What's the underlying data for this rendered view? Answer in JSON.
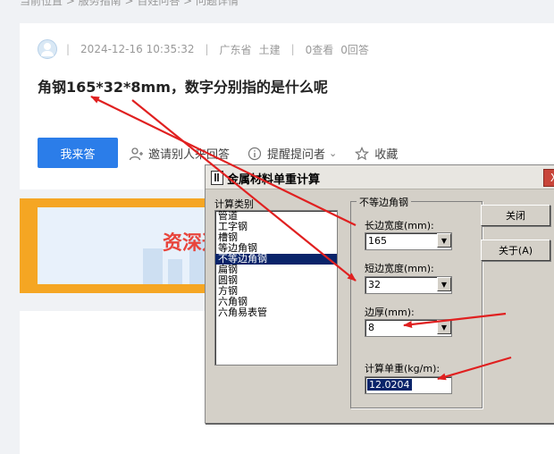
{
  "breadcrumb": "当前位置 > 服务指南 > 百姓问答 > 问题详情",
  "question": {
    "date": "2024-12-16 10:35:32",
    "province": "广东省",
    "category": "土建",
    "views": "0查看",
    "answers": "0回答",
    "title": "角钢165*32*8mm，数字分别指的是什么呢"
  },
  "actions": {
    "answer_label": "我来答",
    "invite_label": "邀请别人来回答",
    "remind_label": "提醒提问者",
    "collect_label": "收藏"
  },
  "banner": {
    "text": "资深造"
  },
  "dialog": {
    "title": "金属材料单重计算",
    "close_x": "X",
    "category_label": "计算类别",
    "categories": [
      "管道",
      "工字钢",
      "槽钢",
      "等边角钢",
      "不等边角钢",
      "扁钢",
      "圆钢",
      "方钢",
      "六角钢",
      "六角易表管"
    ],
    "selected_category": "不等边角钢",
    "group_title": "不等边角钢",
    "long_side_label": "长边宽度(mm):",
    "long_side_value": "165",
    "short_side_label": "短边宽度(mm):",
    "short_side_value": "32",
    "thickness_label": "边厚(mm):",
    "thickness_value": "8",
    "result_label": "计算单重(kg/m):",
    "result_value": "12.0204",
    "close_button": "关闭",
    "about_button": "关于(A)"
  },
  "colors": {
    "accent": "#2b7de9",
    "arrow": "#e02020",
    "banner_border": "#f5a623"
  }
}
